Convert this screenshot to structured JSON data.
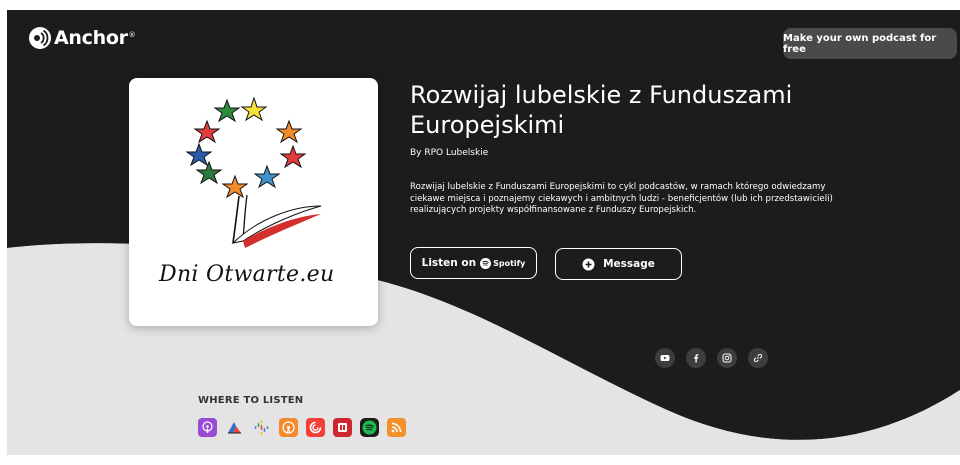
{
  "brand": {
    "name": "Anchor",
    "reg_mark": "®"
  },
  "header": {
    "cta_label": "Make your own podcast for free"
  },
  "cover": {
    "text": "Dni Otwarte.eu"
  },
  "podcast": {
    "title": "Rozwijaj lubelskie z Funduszami Europejskimi",
    "author": "By RPO Lubelskie",
    "description": "Rozwijaj lubelskie z Funduszami Europejskimi to cykl podcastów, w ramach którego odwiedzamy ciekawe miejsca i poznajemy ciekawych i ambitnych ludzi - beneficjentów (lub ich przedstawicieli) realizujących projekty współfinansowane z Funduszy Europejskich."
  },
  "actions": {
    "listen_label": "Listen on",
    "spotify_label": "Spotify",
    "message_label": "Message"
  },
  "social": [
    "youtube-icon",
    "facebook-icon",
    "instagram-icon",
    "link-icon"
  ],
  "where_to_listen": {
    "heading": "WHERE TO LISTEN",
    "platforms": [
      "apple-podcasts",
      "castbox",
      "google-podcasts",
      "overcast",
      "pocket-casts",
      "radiopublic",
      "spotify",
      "rss"
    ]
  },
  "colors": {
    "dark": "#1c1c1c",
    "wave": "#e6e6e6",
    "cta_bg": "#4a4a4a"
  }
}
